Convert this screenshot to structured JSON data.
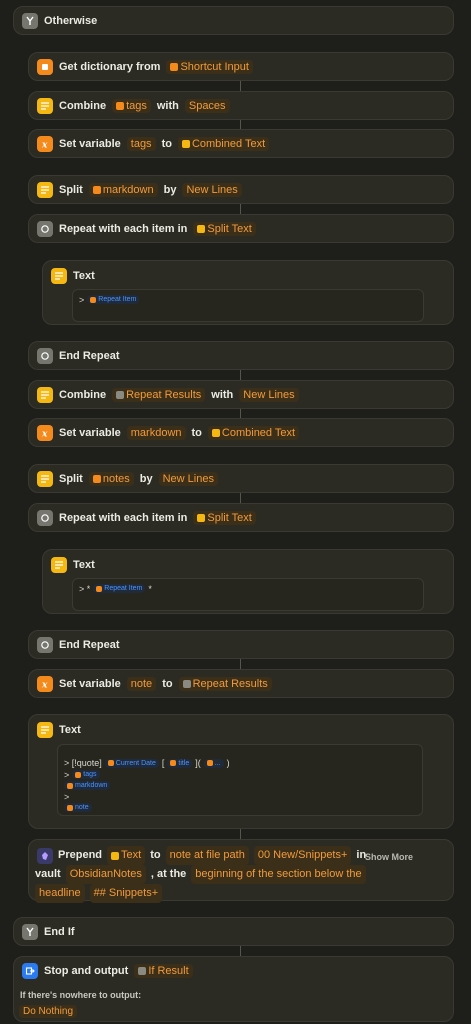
{
  "otherwise": {
    "label": "Otherwise"
  },
  "get_dict": {
    "label": "Get dictionary from",
    "input": "Shortcut Input"
  },
  "combine1": {
    "label": "Combine",
    "var": "tags",
    "with": "with",
    "sep": "Spaces"
  },
  "setvar1": {
    "label": "Set variable",
    "name": "tags",
    "to": "to",
    "value": "Combined Text"
  },
  "split1": {
    "label": "Split",
    "var": "markdown",
    "by": "by",
    "sep": "New Lines"
  },
  "repeat1": {
    "label": "Repeat with each item in",
    "value": "Split Text"
  },
  "text1": {
    "label": "Text",
    "prefix": ">",
    "token": "Repeat Item"
  },
  "endrepeat1": {
    "label": "End Repeat"
  },
  "combine2": {
    "label": "Combine",
    "var": "Repeat Results",
    "with": "with",
    "sep": "New Lines"
  },
  "setvar2": {
    "label": "Set variable",
    "name": "markdown",
    "to": "to",
    "value": "Combined Text"
  },
  "split2": {
    "label": "Split",
    "var": "notes",
    "by": "by",
    "sep": "New Lines"
  },
  "repeat2": {
    "label": "Repeat with each item in",
    "value": "Split Text"
  },
  "text2": {
    "label": "Text",
    "prefix": "> *",
    "token": "Repeat Item",
    "suffix": "*"
  },
  "endrepeat2": {
    "label": "End Repeat"
  },
  "setvar3": {
    "label": "Set variable",
    "name": "note",
    "to": "to",
    "value": "Repeat Results"
  },
  "text3": {
    "label": "Text",
    "line1_prefix": "> [!quote]",
    "line1_date": "Current Date",
    "line1_bracket_open": "[",
    "line1_title": "title",
    "line1_mid": "](",
    "line1_url": "...",
    "line1_close": ")",
    "line2_prefix": ">",
    "line2_token": "tags",
    "line3_token": "markdown",
    "line4_prefix": ">",
    "line5_token": "note"
  },
  "prepend": {
    "label": "Prepend",
    "text_token": "Text",
    "to": "to",
    "target": "note at file path",
    "path": "00 New/Snippets+",
    "in": "in",
    "vault_label": "vault",
    "vault": "ObsidianNotes",
    "at_the": ", at the",
    "position": "beginning of the section below the",
    "headline": "headline",
    "heading": "## Snippets+",
    "show_more": "Show More"
  },
  "endif": {
    "label": "End If"
  },
  "stop": {
    "label": "Stop and output",
    "value": "If Result",
    "nowhere_label": "If there's nowhere to output:",
    "nowhere_value": "Do Nothing"
  }
}
